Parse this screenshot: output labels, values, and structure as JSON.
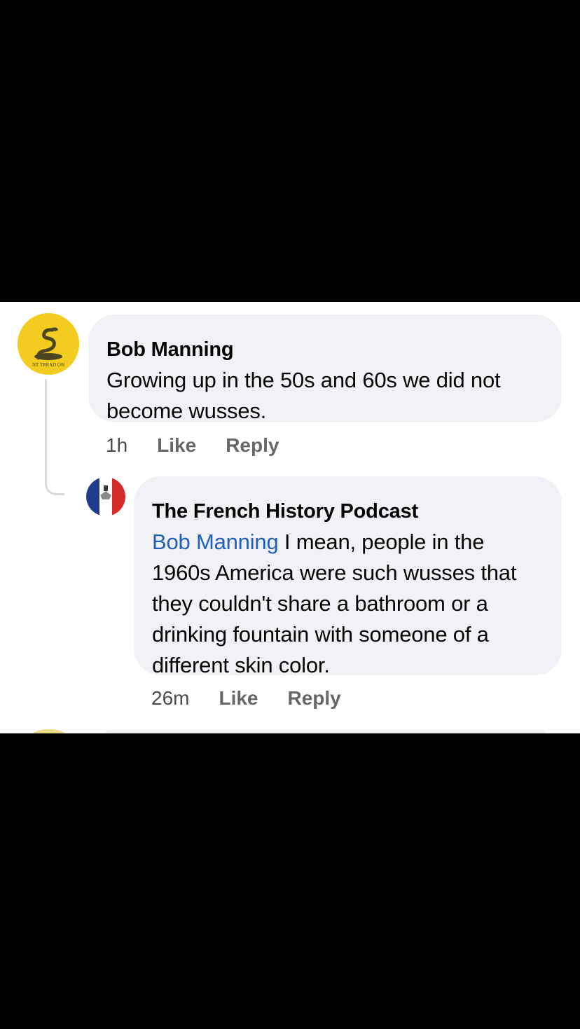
{
  "comment": {
    "author": "Bob Manning",
    "text": "Growing up in the 50s and 60s we did not become wusses.",
    "avatar_text": "NT TREAD ON",
    "time": "1h",
    "like_label": "Like",
    "reply_label": "Reply"
  },
  "reply": {
    "author": "The French History Podcast",
    "mention": "Bob Manning",
    "text": " I mean, people in the 1960s America were such wusses that they couldn't share a bathroom or a drinking fountain with someone of a different skin color.",
    "time": "26m",
    "like_label": "Like",
    "reply_label": "Reply"
  },
  "colors": {
    "background": "#000000",
    "panel": "#ffffff",
    "bubble": "#f0f2f5",
    "mention": "#2160b8",
    "meta": "#65676b",
    "avatar_yellow": "#f2cc1f"
  },
  "icons": {
    "comment_avatar": "gadsden-snake-flag-icon",
    "reply_avatar": "french-flag-crest-icon"
  }
}
